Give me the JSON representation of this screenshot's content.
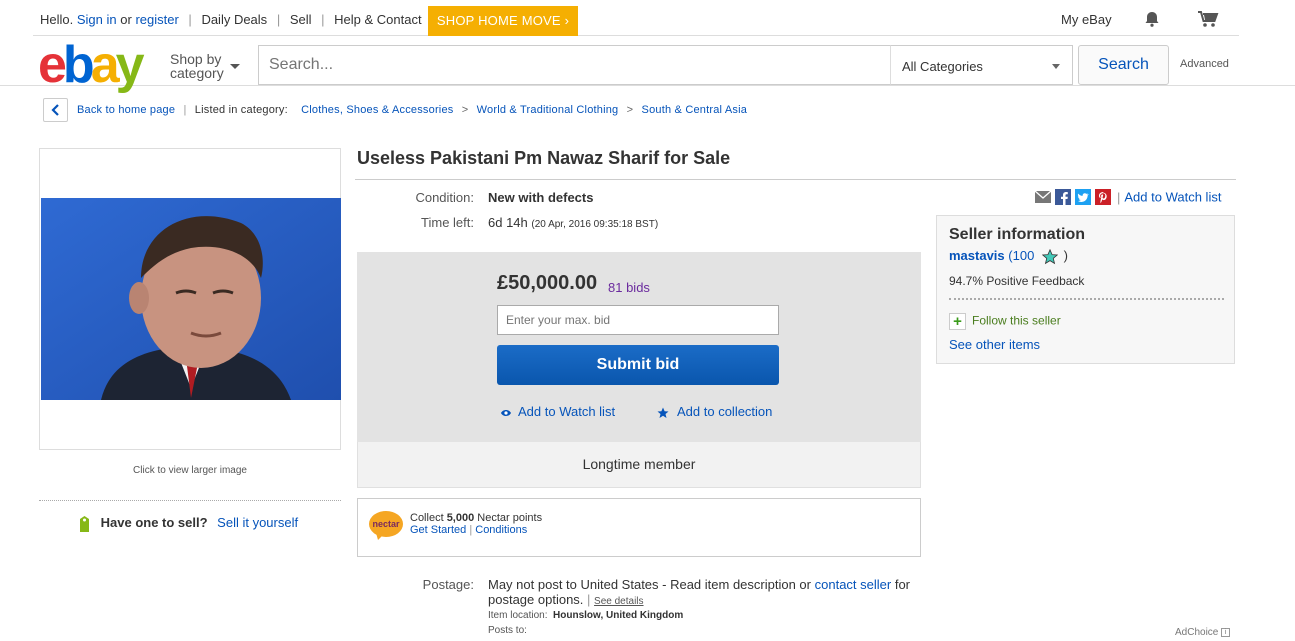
{
  "topbar": {
    "hello": "Hello.",
    "sign_in": "Sign in",
    "or": "or",
    "register": "register",
    "daily_deals": "Daily Deals",
    "sell": "Sell",
    "help": "Help & Contact",
    "promo": "SHOP HOME MOVE",
    "my_ebay": "My eBay"
  },
  "header": {
    "shop_by_1": "Shop by",
    "shop_by_2": "category",
    "search_placeholder": "Search...",
    "category": "All Categories",
    "search_button": "Search",
    "advanced": "Advanced"
  },
  "breadcrumb": {
    "back": "Back to home page",
    "listed_in": "Listed in category:",
    "items": [
      "Clothes, Shoes & Accessories",
      "World & Traditional Clothing",
      "South & Central Asia"
    ]
  },
  "left": {
    "click_larger": "Click to view larger image",
    "have_one": "Have one to sell?",
    "sell_it": "Sell it yourself"
  },
  "item": {
    "title": "Useless Pakistani Pm Nawaz Sharif for Sale",
    "condition_label": "Condition:",
    "condition_value": "New with defects",
    "time_label": "Time left:",
    "time_value": "6d 14h",
    "time_detail": "(20 Apr, 2016   09:35:18 BST)"
  },
  "bid": {
    "price": "£50,000.00",
    "bids": "81 bids",
    "input_placeholder": "Enter your max. bid",
    "submit": "Submit bid",
    "add_watch": "Add to Watch list",
    "add_collection": "Add to collection",
    "longtime": "Longtime member"
  },
  "nectar": {
    "logo": "nectar",
    "collect": "Collect",
    "points": "5,000",
    "points_suffix": "Nectar points",
    "get_started": "Get Started",
    "conditions": "Conditions"
  },
  "postage": {
    "label": "Postage:",
    "text_1": "May not post to United States - Read item description or",
    "contact": "contact seller",
    "text_2": "for postage options.",
    "see_details": "See details",
    "location_label": "Item location:",
    "location": "Hounslow, United Kingdom",
    "posts_to": "Posts to:"
  },
  "share": {
    "add_watch": "Add to Watch list"
  },
  "seller": {
    "heading": "Seller information",
    "name": "mastavis",
    "score": "(100",
    "close": ")",
    "feedback": "94.7% Positive Feedback",
    "follow": "Follow this seller",
    "other": "See other items"
  },
  "adchoice": "AdChoice",
  "colors": {
    "ebay_red": "#e53238",
    "ebay_blue": "#0064d2",
    "ebay_yellow": "#f5af02",
    "ebay_green": "#86b817",
    "link": "#0654ba",
    "bid_button": "#0b5dbb",
    "bids_purple": "#6b2b9e"
  }
}
